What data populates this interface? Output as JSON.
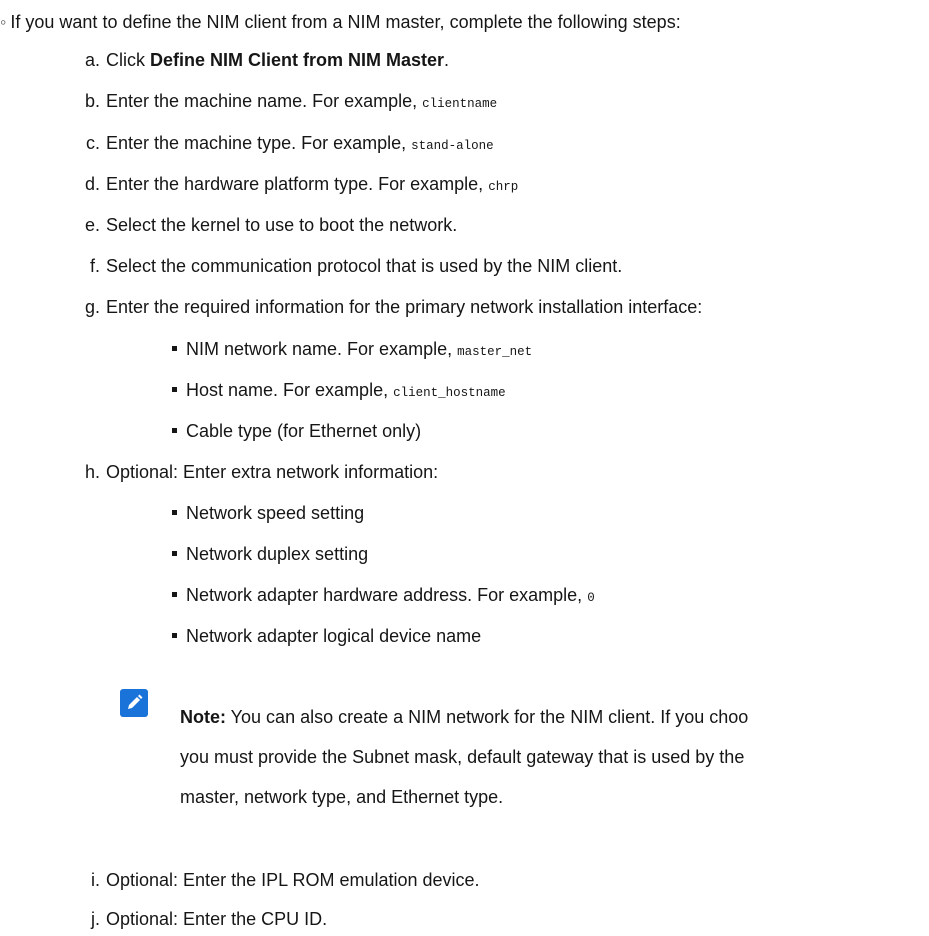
{
  "intro": "If you want to define the NIM client from a NIM master, complete the following steps:",
  "steps": [
    {
      "marker": "a.",
      "pre": "Click ",
      "bold": "Define NIM Client from NIM Master",
      "post": "."
    },
    {
      "marker": "b.",
      "text": "Enter the machine name. For example, ",
      "code": "clientname"
    },
    {
      "marker": "c.",
      "text": "Enter the machine type. For example, ",
      "code": "stand-alone"
    },
    {
      "marker": "d.",
      "text": "Enter the hardware platform type. For example, ",
      "code": "chrp"
    },
    {
      "marker": "e.",
      "text": "Select the kernel to use to boot the network."
    },
    {
      "marker": "f.",
      "text": "Select the communication protocol that is used by the NIM client."
    },
    {
      "marker": "g.",
      "text": "Enter the required information for the primary network installation interface:"
    },
    {
      "marker": "h.",
      "text": "Optional: Enter extra network information:"
    },
    {
      "marker": "i.",
      "text": "Optional: Enter the IPL ROM emulation device."
    },
    {
      "marker": "j.",
      "text": "Optional: Enter the CPU ID."
    }
  ],
  "g_sub": [
    {
      "text": "NIM network name. For example, ",
      "code": "master_net"
    },
    {
      "text": "Host name. For example, ",
      "code": "client_hostname"
    },
    {
      "text": "Cable type (for Ethernet only)"
    }
  ],
  "h_sub": [
    {
      "text": "Network speed setting"
    },
    {
      "text": "Network duplex setting"
    },
    {
      "text": "Network adapter hardware address. For example, ",
      "code": "0"
    },
    {
      "text": "Network adapter logical device name"
    }
  ],
  "note": {
    "label": "Note:",
    "line1": " You can also create a NIM network for the NIM client. If you choo",
    "line2": "you must provide the Subnet mask, default gateway that is used by the",
    "line3": "master, network type, and Ethernet type.",
    "icon": "pencil-note-icon",
    "icon_color": "#1a73d9"
  }
}
